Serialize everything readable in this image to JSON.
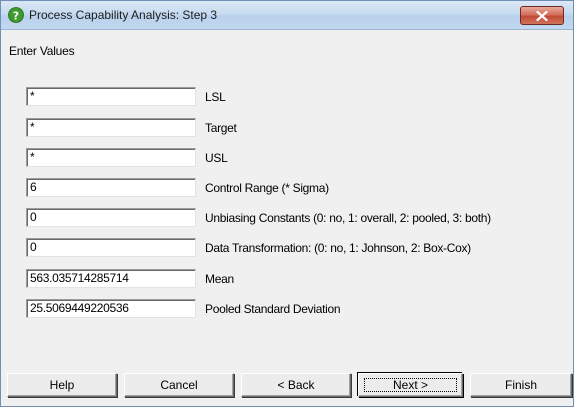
{
  "window": {
    "title": "Process Capability Analysis: Step 3",
    "heading": "Enter Values"
  },
  "fields": [
    {
      "value": "*",
      "label": "LSL"
    },
    {
      "value": "*",
      "label": "Target"
    },
    {
      "value": "*",
      "label": "USL"
    },
    {
      "value": "6",
      "label": "Control Range (* Sigma)"
    },
    {
      "value": "0",
      "label": "Unbiasing Constants (0: no, 1: overall, 2: pooled, 3: both)"
    },
    {
      "value": "0",
      "label": "Data Transformation: (0: no, 1: Johnson, 2: Box-Cox)"
    },
    {
      "value": "563.035714285714",
      "label": "Mean"
    },
    {
      "value": "25.5069449220536",
      "label": "Pooled Standard Deviation"
    }
  ],
  "buttons": {
    "help": "Help",
    "cancel": "Cancel",
    "back": "< Back",
    "next": "Next >",
    "finish": "Finish"
  },
  "icons": {
    "title": "help-question-icon",
    "close": "close-icon"
  },
  "colors": {
    "title_icon": "#3e9a2f",
    "close_button": "#c9503b"
  }
}
